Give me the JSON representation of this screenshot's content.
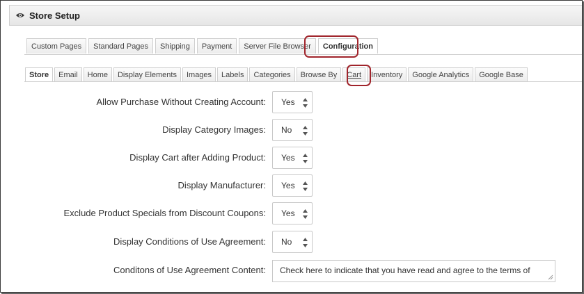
{
  "header": {
    "title": "Store Setup",
    "icon": "eye-icon"
  },
  "top_tabs": [
    {
      "label": "Custom Pages",
      "active": false
    },
    {
      "label": "Standard Pages",
      "active": false
    },
    {
      "label": "Shipping",
      "active": false
    },
    {
      "label": "Payment",
      "active": false
    },
    {
      "label": "Server File Browser",
      "active": false
    },
    {
      "label": "Configuration",
      "active": true,
      "highlighted": true
    }
  ],
  "sub_tabs": [
    {
      "label": "Store",
      "active": true
    },
    {
      "label": "Email",
      "active": false
    },
    {
      "label": "Home",
      "active": false
    },
    {
      "label": "Display Elements",
      "active": false
    },
    {
      "label": "Images",
      "active": false
    },
    {
      "label": "Labels",
      "active": false
    },
    {
      "label": "Categories",
      "active": false
    },
    {
      "label": "Browse By",
      "active": false
    },
    {
      "label": "Cart",
      "active": false,
      "highlighted": true
    },
    {
      "label": "Inventory",
      "active": false
    },
    {
      "label": "Google Analytics",
      "active": false
    },
    {
      "label": "Google Base",
      "active": false
    }
  ],
  "settings": [
    {
      "label": "Allow Purchase Without Creating Account:",
      "value": "Yes"
    },
    {
      "label": "Display Category Images:",
      "value": "No"
    },
    {
      "label": "Display Cart after Adding Product:",
      "value": "Yes"
    },
    {
      "label": "Display Manufacturer:",
      "value": "Yes"
    },
    {
      "label": "Exclude Product Specials from Discount Coupons:",
      "value": "Yes"
    },
    {
      "label": "Display Conditions of Use Agreement:",
      "value": "No"
    }
  ],
  "agreement": {
    "label": "Conditons of Use Agreement Content:",
    "value": "Check here to indicate that you have read and agree to the terms of"
  },
  "colors": {
    "highlight": "#a0242b",
    "tab_border": "#cfcfcf"
  }
}
